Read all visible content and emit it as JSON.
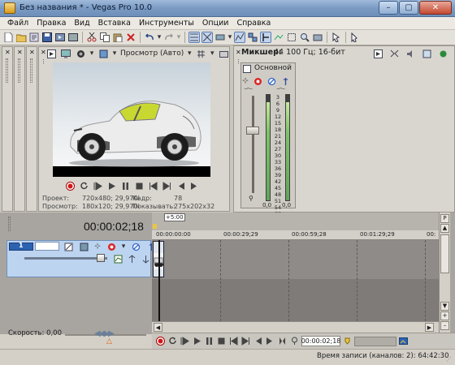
{
  "window": {
    "title": "Без названия * - Vegas Pro 10.0",
    "minimize": "–",
    "maximize": "▢",
    "close": "✕"
  },
  "menu": [
    "Файл",
    "Правка",
    "Вид",
    "Вставка",
    "Инструменты",
    "Опции",
    "Справка"
  ],
  "preview": {
    "dropdown_label": "Просмотр (Авто)",
    "info": {
      "project_label": "Проект:",
      "project_value": "720x480; 29,970i",
      "preview_label": "Просмотр:",
      "preview_value": "180x120; 29,970i",
      "frame_label": "Кадр:",
      "frame_value": "78",
      "display_label": "Показывать:",
      "display_value": "275x202x32"
    }
  },
  "mixer": {
    "title": "Микшер:",
    "format": "44 100 Гц; 16-бит",
    "bus_name": "Основной",
    "scale": [
      "3",
      "6",
      "9",
      "12",
      "15",
      "18",
      "21",
      "24",
      "27",
      "30",
      "33",
      "36",
      "39",
      "42",
      "45",
      "48",
      "51",
      "54",
      "57"
    ],
    "level_left": "0,0",
    "level_right": "0,0"
  },
  "timeline": {
    "timecode": "00:00:02;18",
    "marker": "+5:00",
    "ruler": [
      "00:00:00:00",
      "00:00:29;29",
      "00:00:59;28",
      "00:01:29;29",
      "00:"
    ],
    "track_number": "1",
    "speed_label": "Скорость: 0,00",
    "transport_timecode": "00:00:02;18"
  },
  "status": {
    "record_time": "Время записи (каналов: 2): 64:42:30"
  },
  "colors": {
    "titlebar": "#7b9bc4",
    "track_selected": "#bcd4f0",
    "record": "#d01818",
    "timeline_bg": "#7e7b78"
  }
}
